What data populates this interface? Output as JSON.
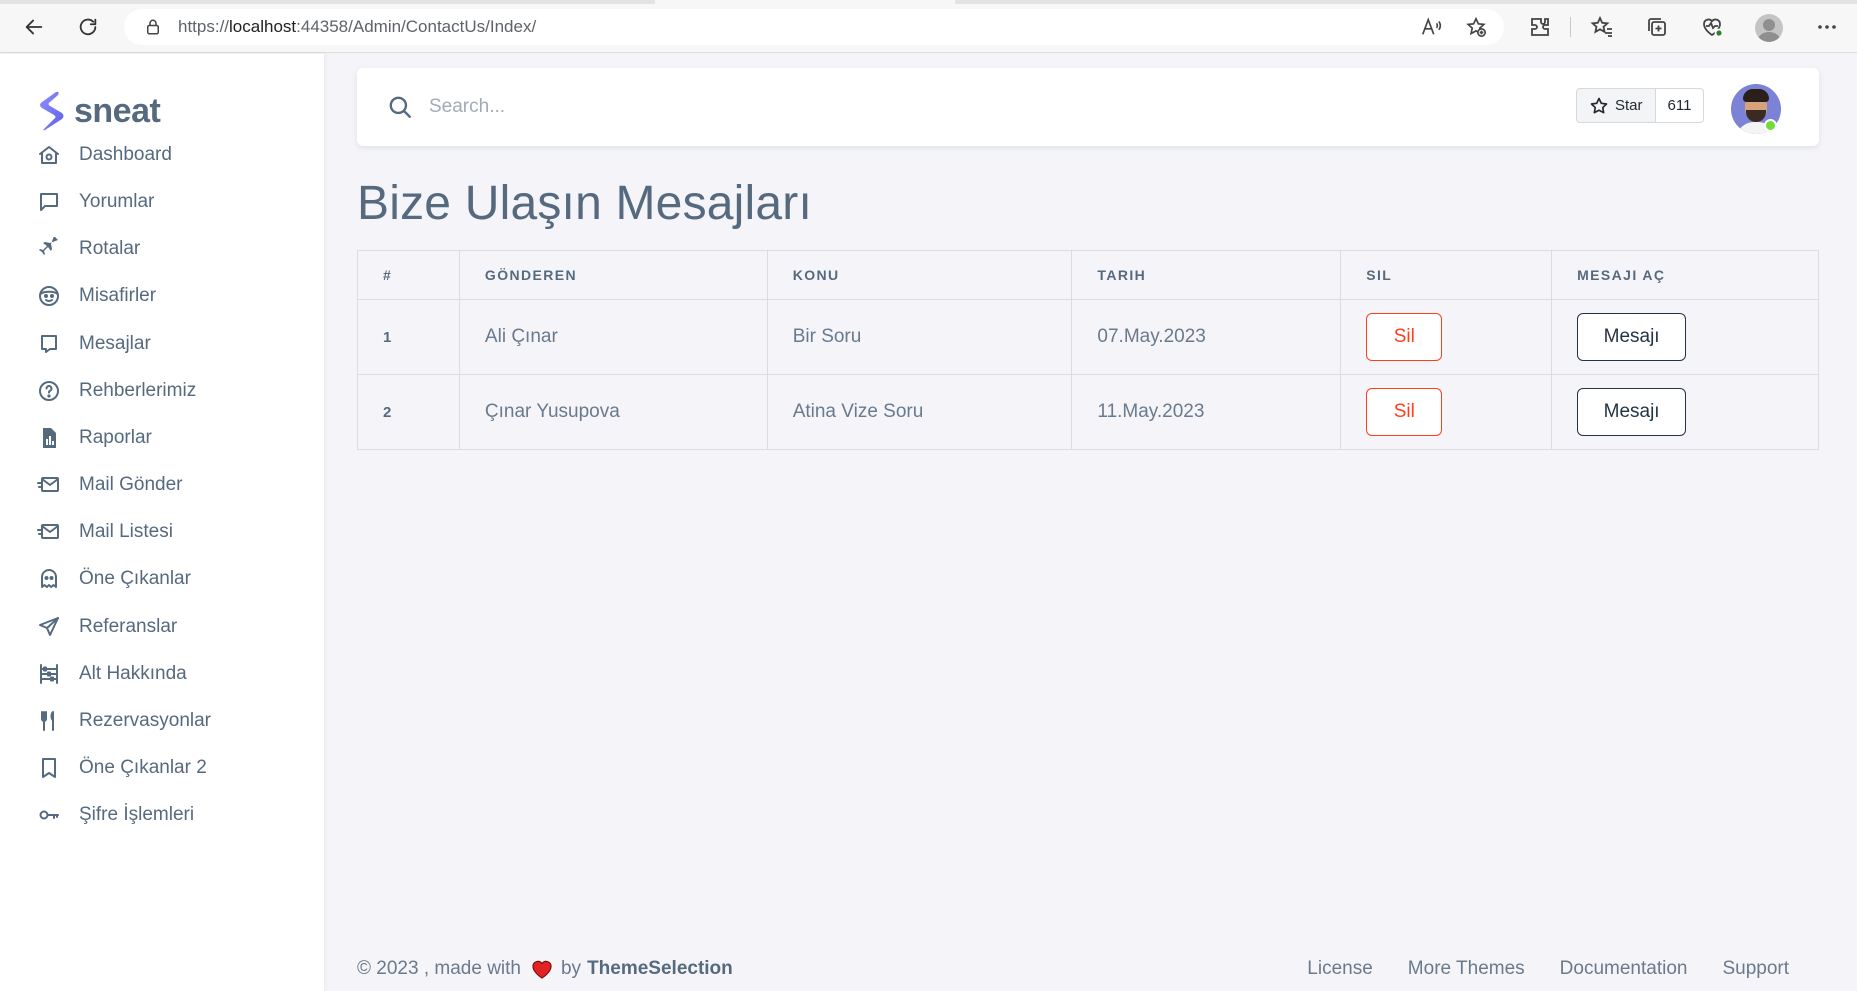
{
  "browser": {
    "url_prefix": "https://",
    "url_host": "localhost",
    "url_rest": ":44358/Admin/ContactUs/Index/"
  },
  "brand": {
    "name": "sneat"
  },
  "sidebar": {
    "items": [
      {
        "label": "Dashboard",
        "icon": "home-icon"
      },
      {
        "label": "Yorumlar",
        "icon": "comment-icon"
      },
      {
        "label": "Rotalar",
        "icon": "plane-icon"
      },
      {
        "label": "Misafirler",
        "icon": "smile-icon"
      },
      {
        "label": "Mesajlar",
        "icon": "message-icon"
      },
      {
        "label": "Rehberlerimiz",
        "icon": "help-circle-icon"
      },
      {
        "label": "Raporlar",
        "icon": "report-file-icon"
      },
      {
        "label": "Mail Gönder",
        "icon": "mail-send-icon"
      },
      {
        "label": "Mail Listesi",
        "icon": "mail-list-icon"
      },
      {
        "label": "Öne Çıkanlar",
        "icon": "ghost-icon"
      },
      {
        "label": "Referanslar",
        "icon": "send-icon"
      },
      {
        "label": "Alt Hakkında",
        "icon": "abacus-icon"
      },
      {
        "label": "Rezervasyonlar",
        "icon": "restaurant-icon"
      },
      {
        "label": "Öne Çıkanlar 2",
        "icon": "bookmark-icon"
      },
      {
        "label": "Şifre İşlemleri",
        "icon": "key-icon"
      }
    ]
  },
  "navbar": {
    "search_placeholder": "Search...",
    "star_label": "Star",
    "star_count": "611"
  },
  "page": {
    "title": "Bize Ulaşın Mesajları"
  },
  "table": {
    "headers": [
      "#",
      "GÖNDEREN",
      "KONU",
      "TARIH",
      "SIL",
      "MESAJI AÇ"
    ],
    "rows": [
      {
        "num": "1",
        "sender": "Ali Çınar",
        "subject": "Bir Soru",
        "date": "07.May.2023",
        "delete_label": "Sil",
        "open_label": "Mesajı"
      },
      {
        "num": "2",
        "sender": "Çınar Yusupova",
        "subject": "Atina Vize Soru",
        "date": "11.May.2023",
        "delete_label": "Sil",
        "open_label": "Mesajı"
      }
    ]
  },
  "footer": {
    "copyright": "© 2023 , made with",
    "by": "by",
    "brand": "ThemeSelection",
    "links": [
      "License",
      "More Themes",
      "Documentation",
      "Support"
    ]
  },
  "colors": {
    "primary": "#696cff",
    "danger": "#ff3e1d",
    "text": "#566a7f",
    "online": "#71dd37"
  }
}
